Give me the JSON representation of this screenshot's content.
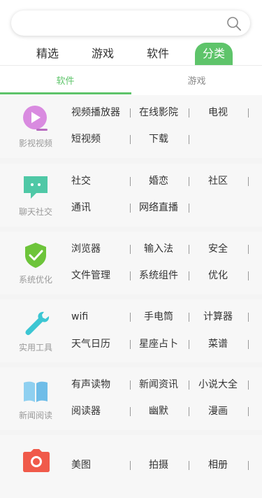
{
  "search": {
    "placeholder": ""
  },
  "tabs": [
    {
      "label": "精选"
    },
    {
      "label": "游戏"
    },
    {
      "label": "软件"
    },
    {
      "label": "分类"
    }
  ],
  "subtabs": [
    {
      "label": "软件"
    },
    {
      "label": "游戏"
    }
  ],
  "categories": [
    {
      "label": "影视视频",
      "icon": "video-play-icon",
      "items": [
        "视频播放器",
        "在线影院",
        "电视",
        "短视频",
        "下载"
      ]
    },
    {
      "label": "聊天社交",
      "icon": "chat-bubble-icon",
      "items": [
        "社交",
        "婚恋",
        "社区",
        "通讯",
        "网络直播"
      ]
    },
    {
      "label": "系统优化",
      "icon": "shield-check-icon",
      "items": [
        "浏览器",
        "输入法",
        "安全",
        "文件管理",
        "系统组件",
        "优化"
      ]
    },
    {
      "label": "实用工具",
      "icon": "wrench-icon",
      "items": [
        "wifi",
        "手电筒",
        "计算器",
        "天气日历",
        "星座占卜",
        "菜谱"
      ]
    },
    {
      "label": "新闻阅读",
      "icon": "book-icon",
      "items": [
        "有声读物",
        "新闻资讯",
        "小说大全",
        "阅读器",
        "幽默",
        "漫画"
      ]
    },
    {
      "label": "",
      "icon": "camera-icon",
      "items": [
        "美图",
        "拍摄",
        "相册"
      ]
    }
  ],
  "colors": {
    "accent": "#5ec46a"
  }
}
